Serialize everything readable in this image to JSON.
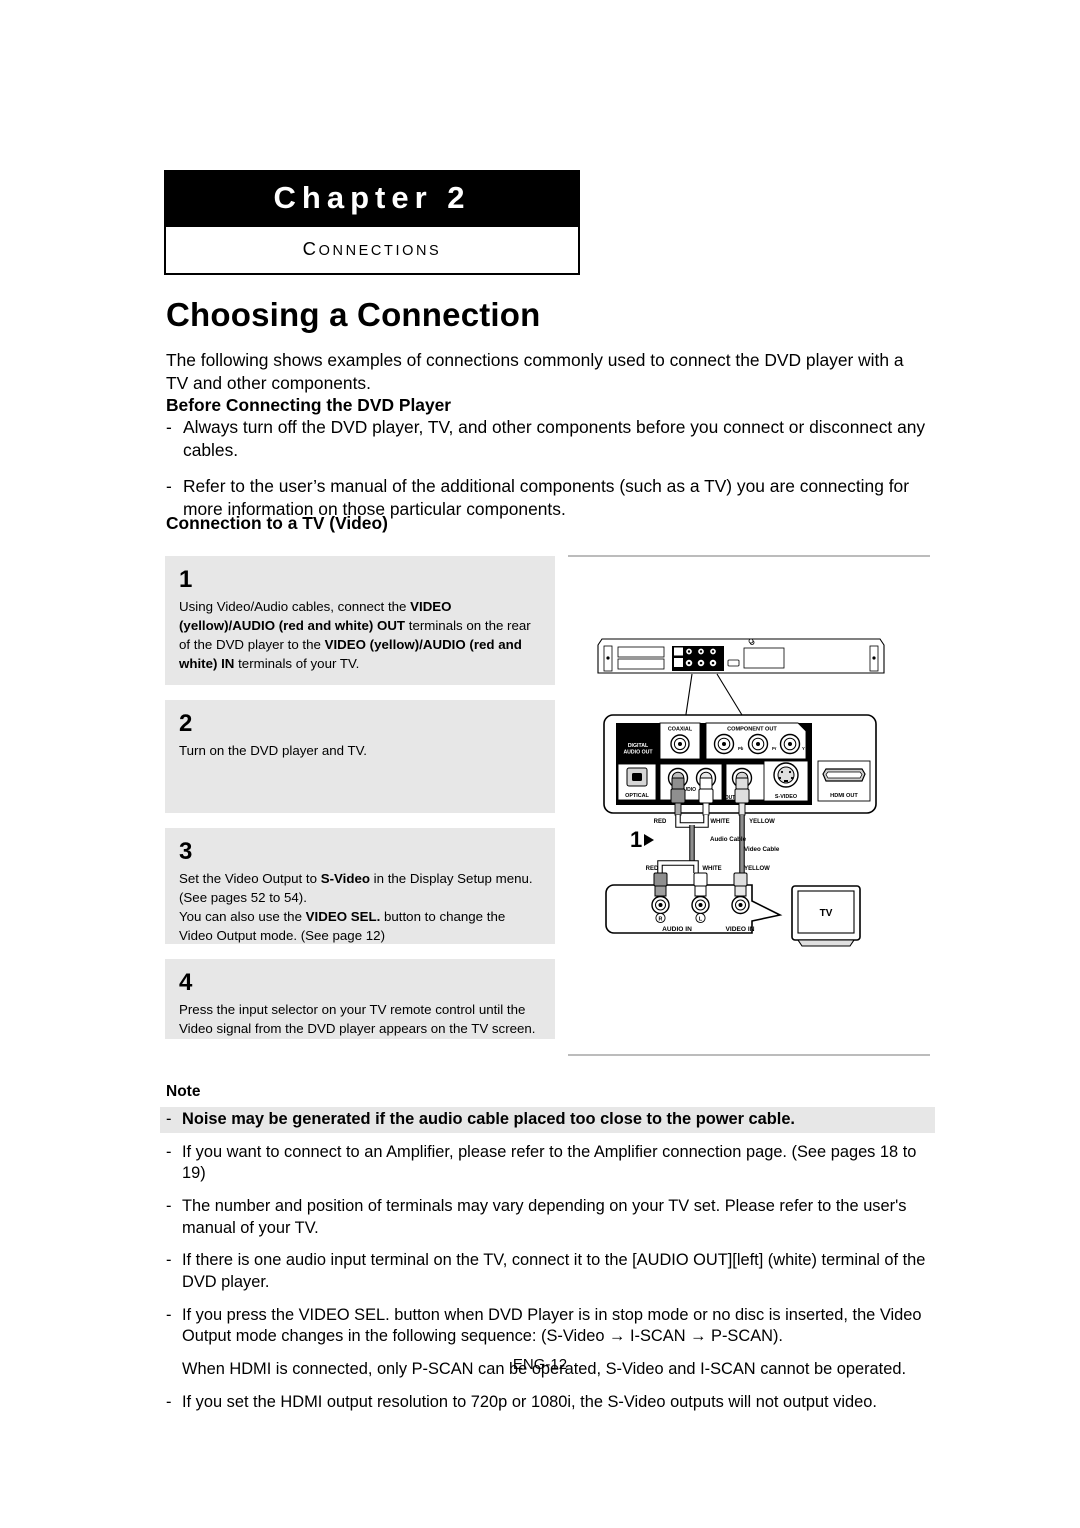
{
  "chapter": {
    "number_label": "Chapter 2",
    "subtitle": "CONNECTIONS",
    "subtitle_first": "C",
    "subtitle_rest": "ONNECTIONS"
  },
  "page_title": "Choosing a Connection",
  "intro": "The following shows examples of connections commonly used to connect the DVD player with a TV and other components.",
  "before_section": {
    "heading": "Before Connecting the DVD Player",
    "dash": "-",
    "bullets": [
      "Always turn off the DVD player, TV, and other components before you connect or disconnect any cables.",
      "Refer to the user’s manual of the additional components (such as a TV) you are connecting for more information on those particular components."
    ]
  },
  "connection_section": {
    "heading": "Connection to a TV (Video)"
  },
  "steps": [
    {
      "number": "1",
      "parts": [
        {
          "text": "Using Video/Audio cables, connect the ",
          "bold": false
        },
        {
          "text": "VIDEO (yellow)/AUDIO (red and white) OUT",
          "bold": true
        },
        {
          "text": " terminals on the rear of the DVD player to the ",
          "bold": false
        },
        {
          "text": "VIDEO (yellow)/AUDIO (red and white) IN",
          "bold": true
        },
        {
          "text": " terminals of your TV.",
          "bold": false
        }
      ]
    },
    {
      "number": "2",
      "parts": [
        {
          "text": "Turn on the DVD player and TV.",
          "bold": false
        }
      ]
    },
    {
      "number": "3",
      "parts": [
        {
          "text": "Set the Video Output to ",
          "bold": false
        },
        {
          "text": "S-Video",
          "bold": true
        },
        {
          "text": " in the Display Setup menu. (See pages 52 to 54).",
          "bold": false
        },
        {
          "text": "\n",
          "bold": false
        },
        {
          "text": "You can also use the ",
          "bold": false
        },
        {
          "text": "VIDEO SEL.",
          "bold": true
        },
        {
          "text": " button to change the Video Output mode. (See page 12)",
          "bold": false
        }
      ]
    },
    {
      "number": "4",
      "parts": [
        {
          "text": "Press the input selector on your TV remote control until the Video signal from the DVD player appears on the TV screen.",
          "bold": false
        }
      ]
    }
  ],
  "note": {
    "label": "Note",
    "dash": "-",
    "items": [
      {
        "text": "Noise may be generated if the audio cable placed too close to the power cable.",
        "bold": true,
        "dashed": true
      },
      {
        "text": "If you want to connect to an Amplifier, please refer to the Amplifier connection page. (See pages 18 to 19)",
        "bold": false,
        "dashed": true
      },
      {
        "text": "The number and position of terminals may vary depending on your TV set. Please refer to the user's manual of your TV.",
        "bold": false,
        "dashed": true
      },
      {
        "text": "If there is one audio input terminal on the TV, connect it to the [AUDIO OUT][left] (white) terminal of the DVD player.",
        "bold": false,
        "dashed": true
      },
      {
        "text": "If you press the VIDEO SEL. button when DVD Player is in stop mode or no disc is inserted, the Video Output mode changes in the following sequence: (S-Video → I-SCAN → P-SCAN).",
        "bold": false,
        "dashed": true
      },
      {
        "text": "When HDMI is connected, only P-SCAN can be operated, S-Video and I-SCAN cannot be operated.",
        "bold": false,
        "dashed": false
      },
      {
        "text": "If you set the HDMI output resolution to 720p or 1080i, the S-Video outputs will not output video.",
        "bold": false,
        "dashed": true
      }
    ]
  },
  "footer": {
    "page_number": "ENG-12"
  },
  "diagram": {
    "labels": {
      "digital_audio_out": "DIGITAL AUDIO OUT",
      "digital_audio_out_l1": "DIGITAL",
      "digital_audio_out_l2": "AUDIO OUT",
      "coaxial": "COAXIAL",
      "component_out": "COMPONENT OUT",
      "optical": "OPTICAL",
      "audio": "AUDIO",
      "out": "OUT",
      "s_video": "S-VIDEO",
      "hdmi_out": "HDMI OUT",
      "component_pb": "Pb",
      "component_pr": "Pr",
      "component_y": "Y",
      "red": "RED",
      "white": "WHITE",
      "yellow": "YELLOW",
      "audio_cable": "Audio Cable",
      "video_cable": "Video Cable",
      "audio_in": "AUDIO IN",
      "video_in": "VIDEO IN",
      "jack_r": "R",
      "jack_l": "L",
      "tv": "TV",
      "step_marker": "1"
    },
    "colors": {
      "panel_black": "#000000",
      "panel_white": "#ffffff",
      "cable_gray": "#808080",
      "body_gray": "#d9d9d9",
      "outline": "#000000"
    }
  }
}
